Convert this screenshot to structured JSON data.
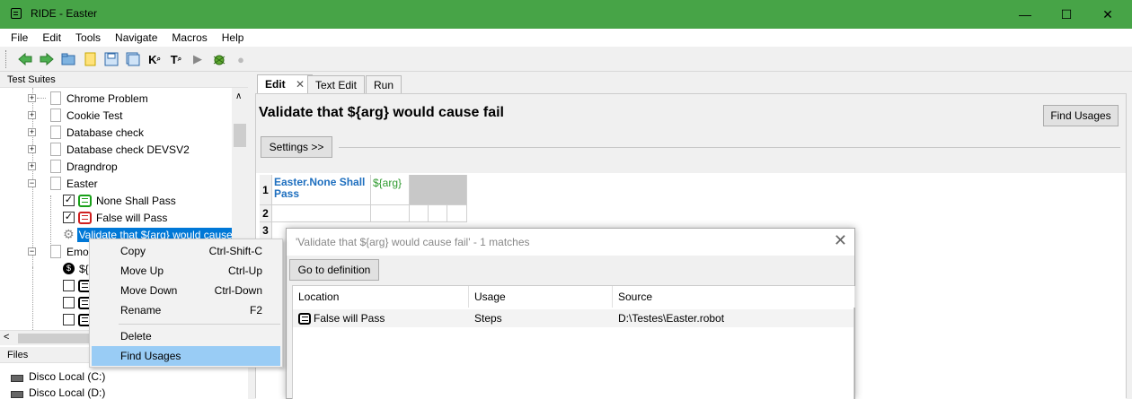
{
  "window": {
    "title": "RIDE - Easter",
    "minimize": "—",
    "maximize": "☐",
    "close": "✕"
  },
  "menu": [
    "File",
    "Edit",
    "Tools",
    "Navigate",
    "Macros",
    "Help"
  ],
  "toolbar": {
    "k_label": "K",
    "t_label": "T"
  },
  "left_panel": {
    "header": "Test Suites",
    "tree": [
      {
        "label": "Chrome Problem"
      },
      {
        "label": "Cookie Test"
      },
      {
        "label": "Database check"
      },
      {
        "label": "Database check DEVSV2"
      },
      {
        "label": "Dragndrop"
      },
      {
        "label": "Easter"
      },
      {
        "label": "None Shall Pass"
      },
      {
        "label": "False will Pass"
      },
      {
        "label": "Validate that ${arg} would cause"
      },
      {
        "label": "Emo"
      },
      {
        "label": "${"
      }
    ],
    "files_header": "Files",
    "drives": [
      "Disco Local (C:)",
      "Disco Local (D:)"
    ]
  },
  "context_menu": {
    "items": [
      {
        "label": "Copy",
        "accel": "Ctrl-Shift-C"
      },
      {
        "label": "Move Up",
        "accel": "Ctrl-Up"
      },
      {
        "label": "Move Down",
        "accel": "Ctrl-Down"
      },
      {
        "label": "Rename",
        "accel": "F2"
      },
      {
        "label": "Delete",
        "accel": ""
      },
      {
        "label": "Find Usages",
        "accel": ""
      }
    ]
  },
  "editor": {
    "tabs": [
      {
        "label": "Edit"
      },
      {
        "label": "Text Edit"
      },
      {
        "label": "Run"
      }
    ],
    "tab_close": "✕",
    "keyword_title": "Validate that ${arg} would cause fail",
    "find_usages_button": "Find Usages",
    "settings_button": "Settings >>",
    "grid": {
      "row_numbers": [
        "1",
        "2",
        "3"
      ],
      "cell_1_1": "Easter.None Shall Pass",
      "cell_1_2": "${arg}"
    }
  },
  "dialog": {
    "title": "'Validate that ${arg} would cause fail' - 1 matches",
    "close": "✕",
    "goto_button": "Go to definition",
    "columns": [
      "Location",
      "Usage",
      "Source"
    ],
    "rows": [
      {
        "location": "False will Pass",
        "usage": "Steps",
        "source": "D:\\Testes\\Easter.robot"
      }
    ]
  },
  "colors": {
    "titlebar": "#47a447",
    "selection": "#0078d7",
    "menu_hover": "#99ccf5",
    "keyword_blue": "#1e6fbf",
    "variable_green": "#2e9a2e"
  }
}
